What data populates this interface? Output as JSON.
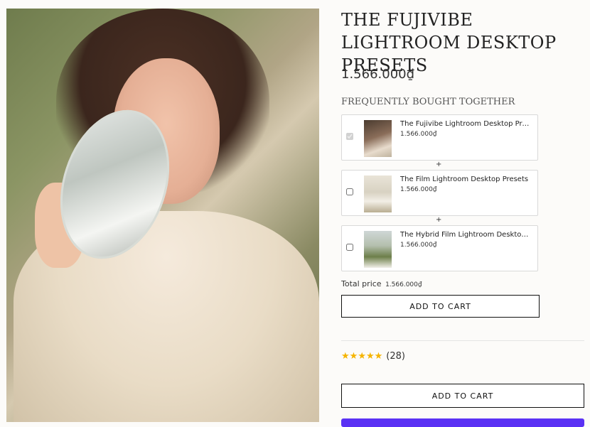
{
  "product": {
    "title": "THE FUJIVIBE LIGHTROOM DESKTOP PRESETS",
    "price": "1.566.000₫",
    "image_icon": "product-photo"
  },
  "fbt": {
    "heading": "FREQUENTLY BOUGHT TOGETHER",
    "plus": "+",
    "items": [
      {
        "name": "The Fujivibe Lightroom Desktop Presets",
        "price": "1.566.000₫",
        "checked": true,
        "disabled": true
      },
      {
        "name": "The Film Lightroom Desktop Presets",
        "price": "1.566.000₫",
        "checked": false,
        "disabled": false
      },
      {
        "name": "The Hybrid Film Lightroom Desktop Presets",
        "price": "1.566.000₫",
        "checked": false,
        "disabled": false
      }
    ],
    "total_label": "Total price",
    "total_value": "1.566.000₫",
    "add_to_cart": "ADD TO CART"
  },
  "rating": {
    "stars": 5,
    "star_icon": "star-icon",
    "count": "(28)",
    "color": "#f5b400"
  },
  "main_add_to_cart": "ADD TO CART",
  "colors": {
    "accent": "#5a31f4",
    "background": "#fcfbf9"
  }
}
